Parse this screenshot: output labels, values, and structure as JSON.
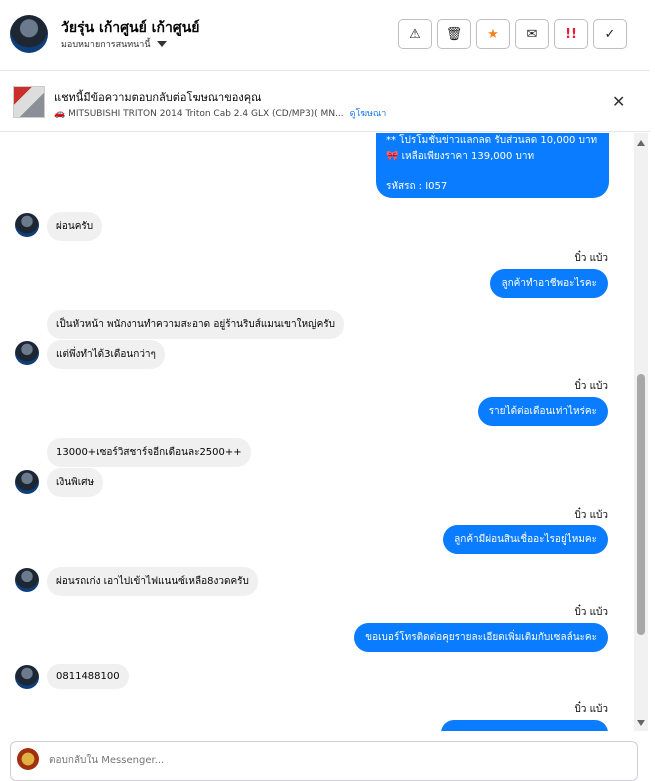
{
  "header": {
    "name": "วัยรุ่น เก้าศูนย์ เก้าศูนย์",
    "assign_label": "มอบหมายการสนทนานี้"
  },
  "toolbar": {
    "icons": [
      "warning-icon",
      "trash-icon",
      "star-icon",
      "envelope-icon",
      "spam-icon",
      "check-icon"
    ]
  },
  "banner": {
    "title": "แชทนี้มีข้อความตอบกลับต่อโฆษณาของคุณ",
    "ad_text": "🚗 MITSUBISHI TRITON 2014 Triton Cab 2.4 GLX (CD/MP3)( MN...",
    "link": "ดูโฆษณา"
  },
  "messages": {
    "promo_line1": "** โปรโมชั่นข่าวแลกลด รับส่วนลด 10,000 บาท",
    "promo_line2": "🎀 เหลือเพียงราคา 139,000 บาท",
    "promo_code": "รหัสรถ : I057",
    "m1": "ผ่อนครับ",
    "s1": "บิ๋ว แบ้ว",
    "m2": "ลูกค้าทำอาชีพอะไรคะ",
    "m3": "เป็นหัวหน้า พนักงานทำความสะอาด  อยู่ร้านริบส์แมนเขาใหญ่ครับ",
    "m4": "แต่พึ่งทำได้3เดือนกว่าๆ",
    "s2": "บิ๋ว แบ้ว",
    "m5": "รายได้ต่อเดือนเท่าไหร่คะ",
    "m6": "13000+เซอร์วิสชาร์จอีกเดือนละ2500++",
    "m7": "เงินพิเศษ",
    "s3": "บิ๋ว แบ้ว",
    "m8": "ลูกค้ามีผ่อนสินเชื่ออะไรอยู่ไหมคะ",
    "m9": "ผ่อนรถเก่ง เอาไปเข้าไฟแนนซ์เหลือ8งวดครับ",
    "s4": "บิ๋ว แบ้ว",
    "m10": "ขอเบอร์โทรติดต่อคุยรายละเอียดเพิ่มเติมกับเซลล์นะคะ",
    "m11": "0811488100",
    "s5": "บิ๋ว แบ้ว"
  },
  "composer": {
    "placeholder": "ตอบกลับใน Messenger..."
  }
}
